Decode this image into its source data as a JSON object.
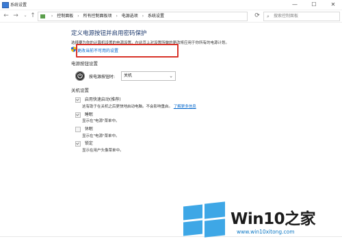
{
  "window": {
    "title": "系统设置",
    "controls": [
      "—",
      "☐",
      "✕"
    ]
  },
  "nav": {
    "back_icon": "back-arrow-icon",
    "forward_icon": "forward-arrow-icon",
    "up_icon": "up-arrow-icon",
    "breadcrumbs": [
      "控制面板",
      "所有控制面板项",
      "电源选项",
      "系统设置"
    ],
    "separator": "›",
    "search_placeholder": "搜索控制面板",
    "refresh_icon": "refresh-icon"
  },
  "main": {
    "heading": "定义电源按钮并启用密码保护",
    "subtext": "选择要为你的计算机设置的电源设置。在此页上对设置所做的更改将应用于你所有的电源计划。",
    "change_link": "更改当前不可用的设置",
    "section_power": "电源按钮设置",
    "power_label": "按电源按钮时:",
    "power_value": "关机",
    "section_shutdown": "关机设置",
    "options": [
      {
        "label": "启用快速启动(推荐)",
        "desc": "这有助于在关机之后更快地启动电脑。不会影响重启。",
        "link": "了解更多信息",
        "checked": true
      },
      {
        "label": "睡眠",
        "desc": "显示在\"电源\"菜单中。",
        "checked": true
      },
      {
        "label": "休眠",
        "desc": "显示在\"电源\"菜单中。",
        "checked": false
      },
      {
        "label": "锁定",
        "desc": "显示在用户头像菜单中。",
        "checked": true
      }
    ]
  },
  "watermark": {
    "brand": "Win10",
    "brand_suffix": "之家",
    "url": "www.win10xitong.com"
  },
  "colors": {
    "link": "#0066cc",
    "highlight": "#d83228",
    "heading": "#1e3a6e",
    "logo_blue": "#3ea7e6"
  }
}
